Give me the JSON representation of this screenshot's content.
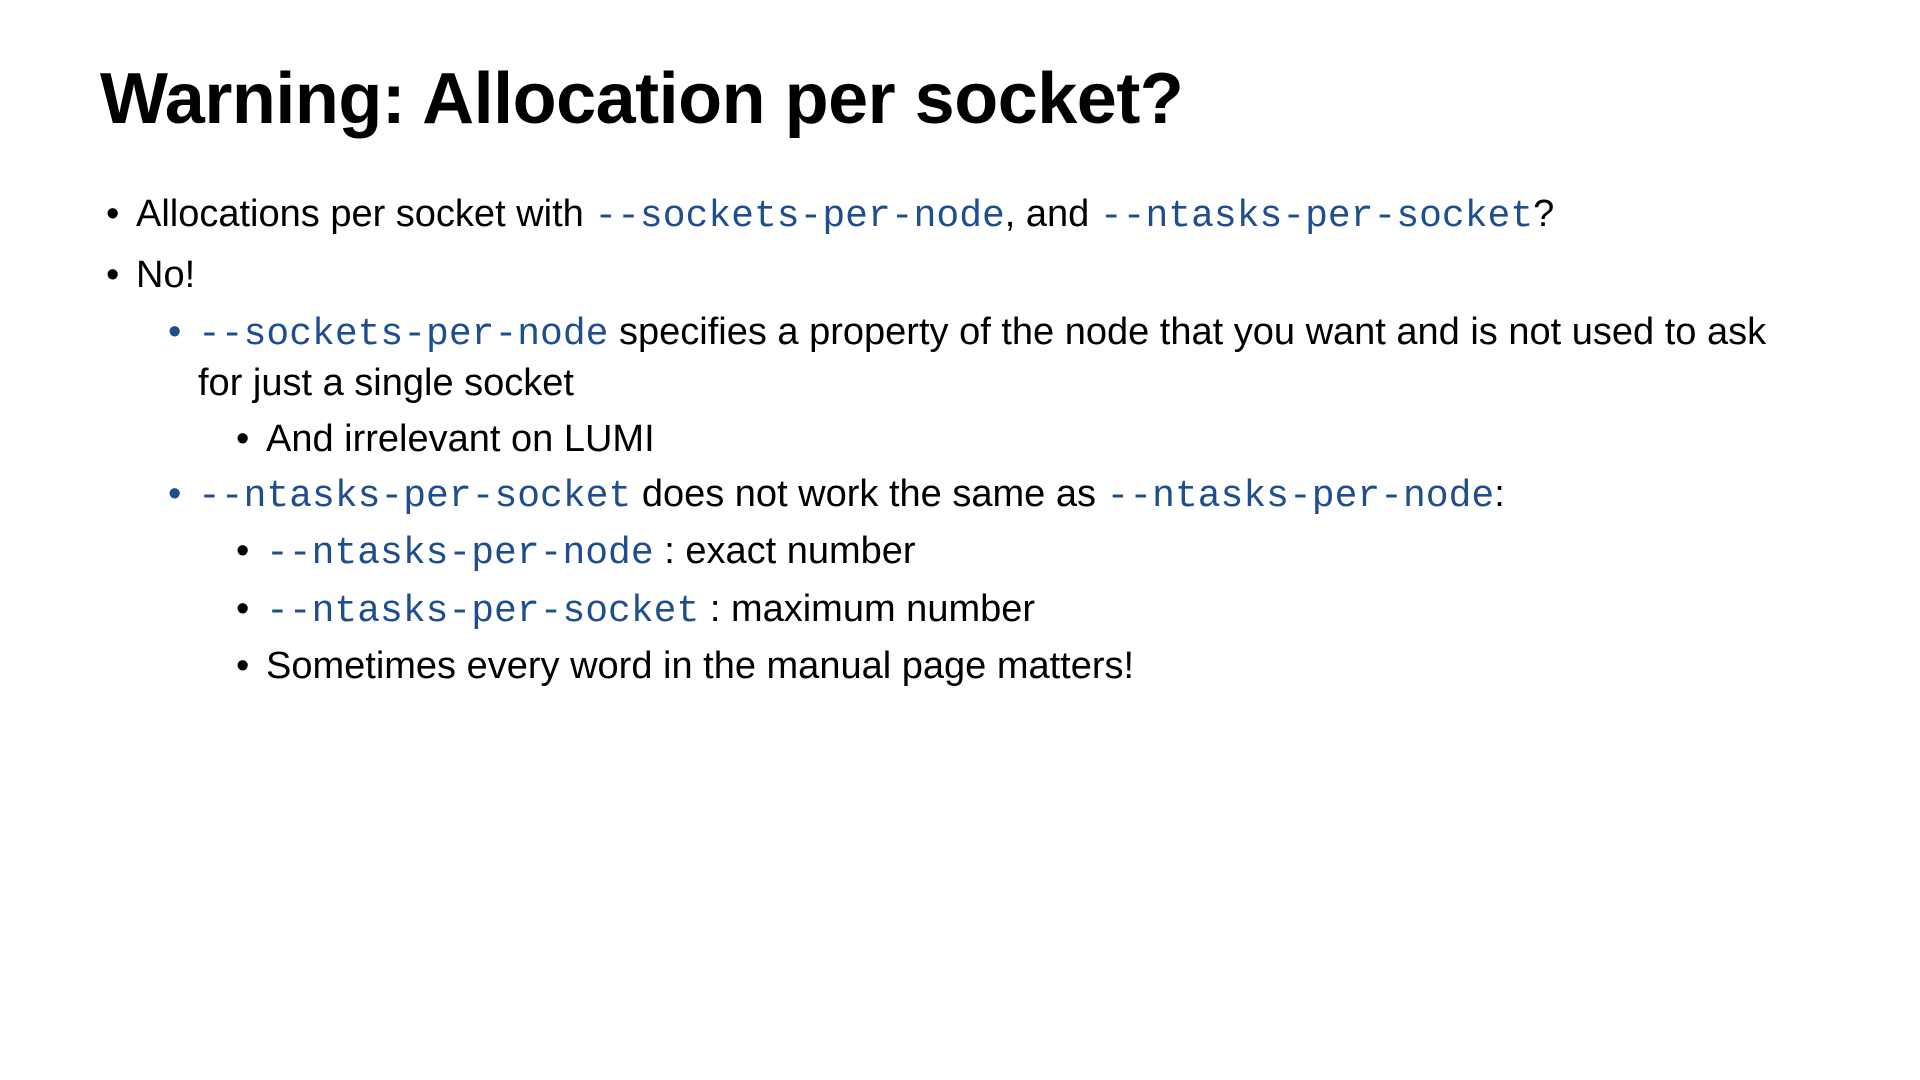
{
  "title": "Warning: Allocation per socket?",
  "colors": {
    "code": "#1f4e8e",
    "bullet_lvl2": "#1f4e8e"
  },
  "b1": {
    "pre": "Allocations per socket with ",
    "c1": "--sockets-per-node",
    "mid": ", and ",
    "c2": "--ntasks-per-socket",
    "post": "?"
  },
  "b2": {
    "text": "No!"
  },
  "b2_1": {
    "c": "--sockets-per-node",
    "post": " specifies a property of the node that you want and is not used to ask for just a single socket"
  },
  "b2_1_a": {
    "text": "And irrelevant on LUMI"
  },
  "b2_2": {
    "c1": "--ntasks-per-socket",
    "mid": " does not work the same as ",
    "c2": "--ntasks-per-node",
    "post": ":"
  },
  "b2_2_a": {
    "c": "--ntasks-per-node",
    "post": " : exact number"
  },
  "b2_2_b": {
    "c": "--ntasks-per-socket",
    "post": " : maximum number"
  },
  "b2_2_c": {
    "text": "Sometimes every word in the manual page matters!"
  }
}
